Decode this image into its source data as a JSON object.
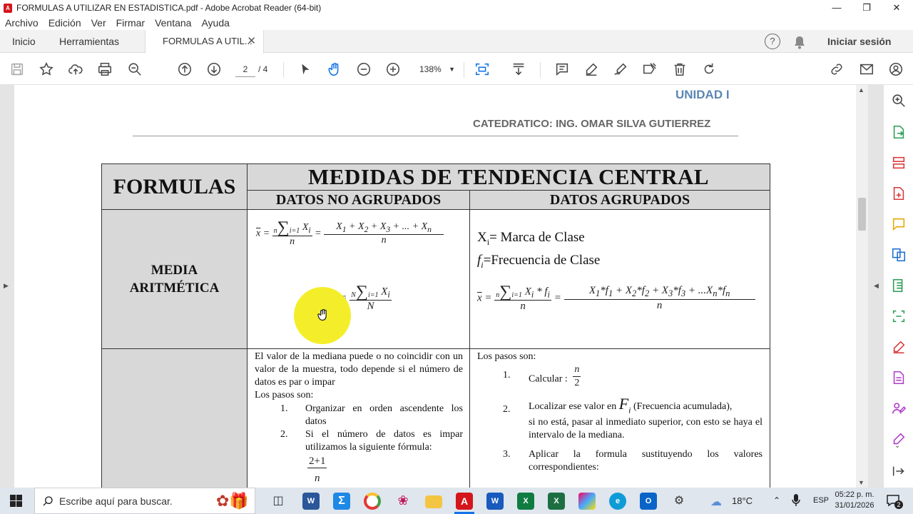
{
  "window": {
    "title": "FORMULAS A UTILIZAR EN ESTADISTICA.pdf - Adobe Acrobat Reader (64-bit)"
  },
  "menu": [
    "Archivo",
    "Edición",
    "Ver",
    "Firmar",
    "Ventana",
    "Ayuda"
  ],
  "tabs": {
    "home": "Inicio",
    "tools": "Herramientas",
    "document": "FORMULAS A UTIL...",
    "signin": "Iniciar sesión"
  },
  "toolbar": {
    "page_current": "2",
    "page_total": "/ 4",
    "zoom": "138%"
  },
  "document": {
    "unit": "UNIDAD I",
    "teacher": "CATEDRATICO: ING. OMAR SILVA GUTIERREZ",
    "table": {
      "corner": "FORMULAS",
      "main_header": "MEDIDAS DE TENDENCIA CENTRAL",
      "col_ungrouped": "DATOS NO AGRUPADOS",
      "col_grouped": "DATOS AGRUPADOS",
      "row1_label_1": "MEDIA",
      "row1_label_2": "ARITMÉTICA",
      "xi_def_suffix": "= Marca de Clase",
      "fi_def_suffix": "=Frecuencia de Clase",
      "median_intro": "El valor de la mediana puede o no coincidir con un valor de la muestra, todo depende si el número de datos es par o impar",
      "steps_label": "Los pasos son:",
      "ng_step1_num": "1.",
      "ng_step1": "Organizar en orden ascendente los datos",
      "ng_step2_num": "2.",
      "ng_step2": "Si el número de datos es impar utilizamos la siguiente fórmula:",
      "ng_frac_num": "2+1",
      "ng_frac_den": "n",
      "g_steps_label": "Los pasos son:",
      "g_step1_num": "1.",
      "g_step1": "Calcular :",
      "g_step1_num_frac": "n",
      "g_step1_den_frac": "2",
      "g_step2_num": "2.",
      "g_step2_a": "Localizar ese valor en",
      "g_step2_b": "(Frecuencia acumulada),",
      "g_step2_c": "si no está, pasar al inmediato superior, con esto se haya el intervalo de la mediana.",
      "g_step3_num": "3.",
      "g_step3": "Aplicar la formula sustituyendo los valores correspondientes:"
    }
  },
  "taskbar": {
    "search_placeholder": "Escribe aquí para buscar.",
    "weather": "18°C",
    "lang": "ESP",
    "time": "05:22 p. m.",
    "date": "31/01/2026",
    "notif_count": "2"
  }
}
